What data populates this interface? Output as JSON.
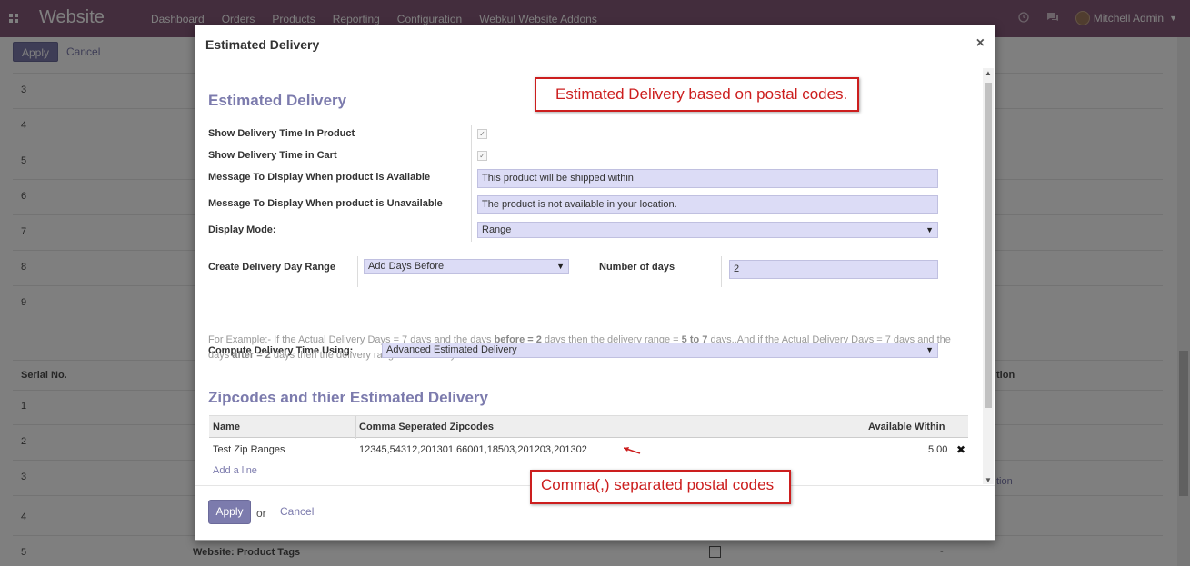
{
  "navbar": {
    "brand": "Website",
    "menu": [
      "Dashboard",
      "Orders",
      "Products",
      "Reporting",
      "Configuration",
      "Webkul Website Addons"
    ],
    "user": "Mitchell Admin",
    "icons": [
      "apps-icon",
      "clock-icon",
      "chat-icon",
      "avatar",
      "caret-down-icon"
    ]
  },
  "control_panel": {
    "apply": "Apply",
    "cancel": "Cancel"
  },
  "background": {
    "rows_top": [
      "3",
      "4",
      "5",
      "6",
      "7",
      "8",
      "9"
    ],
    "header_serial": "Serial No.",
    "header_right": "tion",
    "rows_bottom": [
      "1",
      "2",
      "3",
      "4",
      "5"
    ],
    "link_right": "tion",
    "last_row_label": "Website: Product Tags",
    "last_row_value": "-"
  },
  "modal": {
    "title": "Estimated Delivery",
    "close": "×",
    "section1_title": "Estimated Delivery",
    "labels": {
      "show_product": "Show Delivery Time In Product",
      "show_cart": "Show Delivery Time in Cart",
      "msg_available": "Message To Display When product is Available",
      "msg_unavailable": "Message To Display When product is Unavailable",
      "display_mode": "Display Mode:",
      "day_range": "Create Delivery Day Range",
      "num_days": "Number of days",
      "compute": "Compute Delivery Time Using:"
    },
    "values": {
      "show_product": true,
      "show_cart": true,
      "msg_available": "This product will be shipped within",
      "msg_unavailable": "The product is not available in your location.",
      "display_mode": "Range",
      "day_range": "Add Days Before",
      "num_days": "2",
      "compute": "Advanced Estimated Delivery"
    },
    "help": {
      "p1": "For Example:- If the Actual Delivery Days = 7 days and the days ",
      "b1": "before = 2",
      "p2": " days then the delivery range = ",
      "b2": "5 to 7",
      "p3": " days..And if the Actual Delivery Days = 7 days and the days ",
      "b3": "after = 2",
      "p4": " days then the delivery range = ",
      "b4": "7 to 9",
      "p5": " days"
    },
    "section2_title": "Zipcodes and thier Estimated Delivery",
    "table": {
      "columns": [
        "Name",
        "Comma Seperated Zipcodes",
        "Available Within"
      ],
      "rows": [
        {
          "name": "Test Zip Ranges",
          "zipcodes": "12345,54312,201301,66001,18503,201203,201302",
          "available": "5.00"
        }
      ],
      "add_line": "Add a line"
    },
    "footer": {
      "apply": "Apply",
      "or": "or",
      "cancel": "Cancel"
    }
  },
  "annotations": {
    "top": "Estimated Delivery based on postal codes.",
    "bottom": "Comma(,) separated postal codes"
  },
  "colors": {
    "navbar": "#875a7b",
    "primary": "#7c7bad",
    "field_bg": "#dcdcf6",
    "annotation": "#cc1e1e"
  }
}
